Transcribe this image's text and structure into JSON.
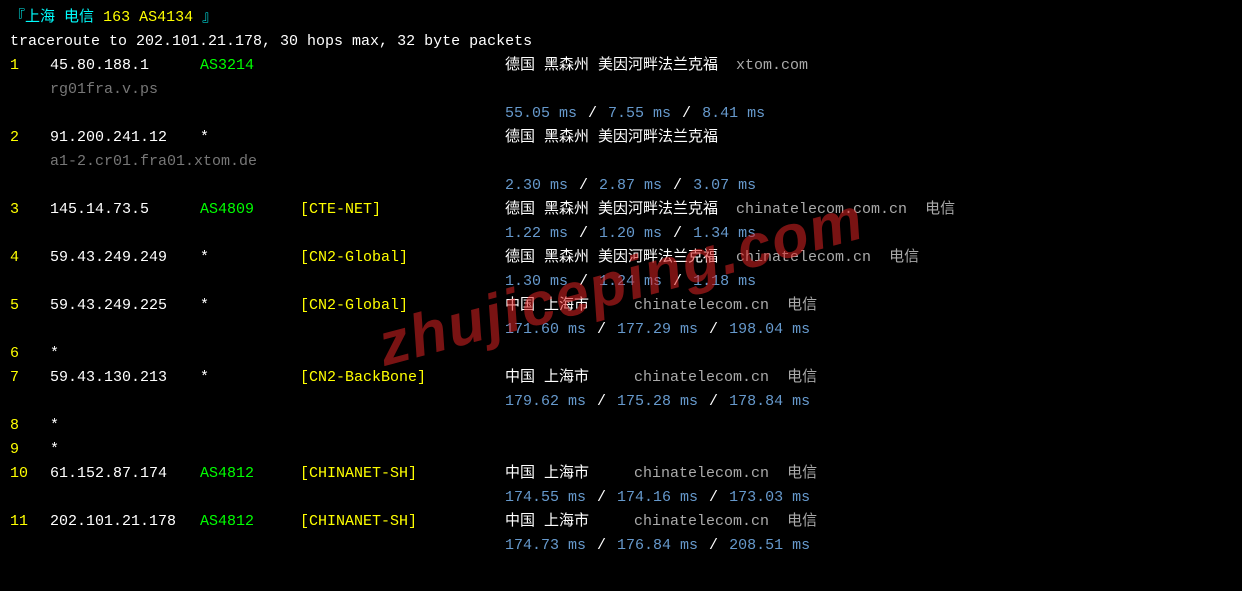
{
  "header": {
    "open": "『",
    "loc": "上海",
    "isp": "电信",
    "asn_label": "163 AS4134",
    "close": "』"
  },
  "subheader": "traceroute to 202.101.21.178, 30 hops max, 32 byte packets",
  "hops": [
    {
      "n": "1",
      "ip": "45.80.188.1",
      "asn": "AS3214",
      "tag": "",
      "loc": "德国 黑森州 美因河畔法兰克福",
      "host": "xtom.com",
      "isp": "",
      "rdns": "rg01fra.v.ps",
      "timings": [
        "55.05 ms",
        "7.55 ms",
        "8.41 ms"
      ]
    },
    {
      "n": "2",
      "ip": "91.200.241.12",
      "asn": "*",
      "tag": "",
      "loc": "德国 黑森州 美因河畔法兰克福",
      "host": "",
      "isp": "",
      "rdns": "a1-2.cr01.fra01.xtom.de",
      "timings": [
        "2.30 ms",
        "2.87 ms",
        "3.07 ms"
      ]
    },
    {
      "n": "3",
      "ip": "145.14.73.5",
      "asn": "AS4809",
      "tag": "[CTE-NET]",
      "loc": "德国 黑森州 美因河畔法兰克福",
      "host": "chinatelecom.com.cn",
      "isp": "电信",
      "rdns": "",
      "timings": [
        "1.22 ms",
        "1.20 ms",
        "1.34 ms"
      ]
    },
    {
      "n": "4",
      "ip": "59.43.249.249",
      "asn": "*",
      "tag": "[CN2-Global]",
      "loc": "德国 黑森州 美因河畔法兰克福",
      "host": "chinatelecom.cn",
      "isp": "电信",
      "rdns": "",
      "timings": [
        "1.30 ms",
        "1.24 ms",
        "1.18 ms"
      ]
    },
    {
      "n": "5",
      "ip": "59.43.249.225",
      "asn": "*",
      "tag": "[CN2-Global]",
      "loc": "中国 上海市",
      "host": "chinatelecom.cn",
      "isp": "电信",
      "rdns": "",
      "timings": [
        "171.60 ms",
        "177.29 ms",
        "198.04 ms"
      ]
    },
    {
      "n": "6",
      "ip": "*",
      "noresp": true
    },
    {
      "n": "7",
      "ip": "59.43.130.213",
      "asn": "*",
      "tag": "[CN2-BackBone]",
      "loc": "中国 上海市",
      "host": "chinatelecom.cn",
      "isp": "电信",
      "rdns": "",
      "timings": [
        "179.62 ms",
        "175.28 ms",
        "178.84 ms"
      ]
    },
    {
      "n": "8",
      "ip": "*",
      "noresp": true
    },
    {
      "n": "9",
      "ip": "*",
      "noresp": true
    },
    {
      "n": "10",
      "ip": "61.152.87.174",
      "asn": "AS4812",
      "tag": "[CHINANET-SH]",
      "loc": "中国 上海市",
      "host": "chinatelecom.cn",
      "isp": "电信",
      "rdns": "",
      "timings": [
        "174.55 ms",
        "174.16 ms",
        "173.03 ms"
      ]
    },
    {
      "n": "11",
      "ip": "202.101.21.178",
      "asn": "AS4812",
      "tag": "[CHINANET-SH]",
      "loc": "中国 上海市",
      "host": "chinatelecom.cn",
      "isp": "电信",
      "rdns": "",
      "timings": [
        "174.73 ms",
        "176.84 ms",
        "208.51 ms"
      ]
    }
  ],
  "watermark": "zhujiceping.com"
}
